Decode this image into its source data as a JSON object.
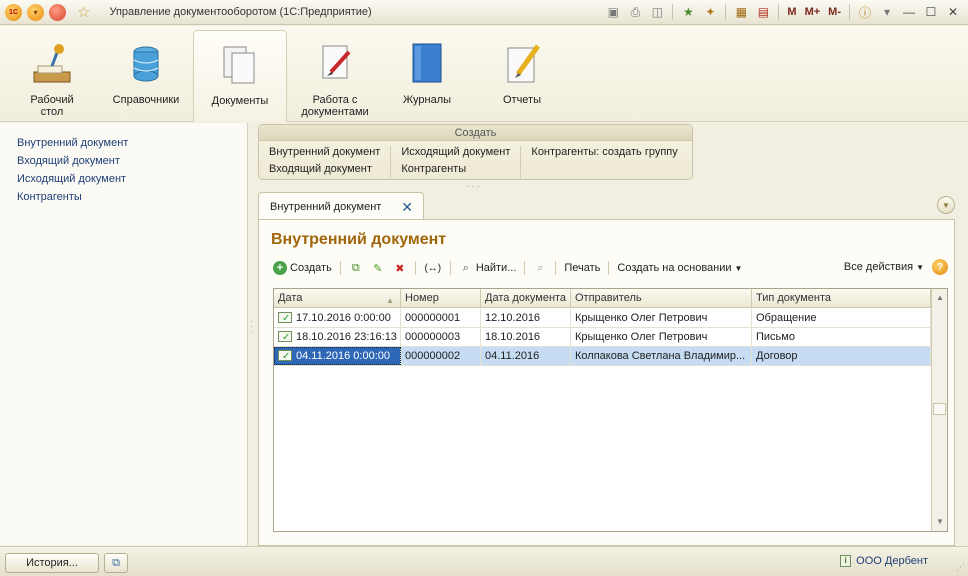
{
  "window": {
    "title": "Управление документооборотом  (1С:Предприятие)",
    "logo": "1С",
    "m_buttons": [
      "M",
      "M+",
      "M-"
    ]
  },
  "sections": [
    {
      "label": "Рабочий стол",
      "icon": "desk-lamp-icon"
    },
    {
      "label": "Справочники",
      "icon": "database-icon"
    },
    {
      "label": "Документы",
      "icon": "documents-icon",
      "active": true
    },
    {
      "label": "Работа с документами",
      "icon": "document-pen-icon"
    },
    {
      "label": "Журналы",
      "icon": "journal-book-icon"
    },
    {
      "label": "Отчеты",
      "icon": "report-pencil-icon"
    }
  ],
  "leftnav": {
    "items": [
      "Внутренний документ",
      "Входящий документ",
      "Исходящий документ",
      "Контрагенты"
    ]
  },
  "create_panel": {
    "title": "Создать",
    "col1": [
      "Внутренний документ",
      "Входящий документ"
    ],
    "col2": [
      "Исходящий документ",
      "Контрагенты"
    ],
    "col3": [
      "Контрагенты: создать группу"
    ]
  },
  "tab": {
    "label": "Внутренний документ"
  },
  "form": {
    "title": "Внутренний документ"
  },
  "toolbar": {
    "create": "Создать",
    "find": "Найти...",
    "print": "Печать",
    "create_based": "Создать на основании",
    "all_actions": "Все действия",
    "help": "?"
  },
  "table": {
    "columns": [
      "Дата",
      "Номер",
      "Дата документа",
      "Отправитель",
      "Тип документа"
    ],
    "rows": [
      {
        "date": "17.10.2016 0:00:00",
        "number": "000000001",
        "doc_date": "12.10.2016",
        "sender": "Крыщенко Олег Петрович",
        "type": "Обращение"
      },
      {
        "date": "18.10.2016 23:16:13",
        "number": "000000003",
        "doc_date": "18.10.2016",
        "sender": "Крыщенко Олег Петрович",
        "type": "Письмо"
      },
      {
        "date": "04.11.2016 0:00:00",
        "number": "000000002",
        "doc_date": "04.11.2016",
        "sender": "Колпакова Светлана Владимир...",
        "type": "Договор",
        "selected": true
      }
    ]
  },
  "statusbar": {
    "history": "История...",
    "org": "ООО Дербент"
  },
  "colors": {
    "accent_title": "#a0660a",
    "link": "#1e3f78",
    "selection": "#2f67b7",
    "selection_row": "#c6dcf3"
  }
}
